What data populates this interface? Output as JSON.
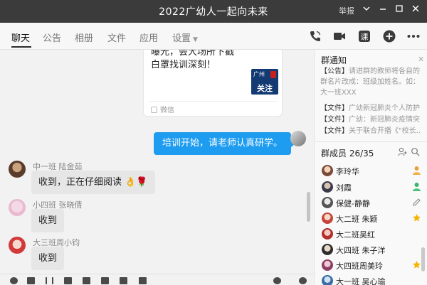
{
  "window": {
    "title": "2022广幼人一起向未来",
    "report_label": "举报"
  },
  "tabs": [
    {
      "label": "聊天",
      "active": true
    },
    {
      "label": "公告"
    },
    {
      "label": "相册"
    },
    {
      "label": "文件"
    },
    {
      "label": "应用"
    },
    {
      "label": "设置"
    }
  ],
  "toolbar_icons": [
    "phone-icon",
    "video-icon",
    "course-icon",
    "add-icon",
    "more-icon"
  ],
  "toolbar": {
    "course_label": "课"
  },
  "chat": {
    "share_card": {
      "text": "曝光，会大场所下戳白罩找训深刻！",
      "logo_text": "广州",
      "logo_follow": "关注",
      "source": "微信"
    },
    "my_message": "培训开始，请老师认真研学。",
    "messages": [
      {
        "name": "中一班 陆金茹",
        "text": "收到，正在仔细阅读",
        "emoji": "👌🌹"
      },
      {
        "name": "小四班 张晓倩",
        "text": "收到"
      },
      {
        "name": "大三班周小钧",
        "text": "收到"
      }
    ]
  },
  "panel": {
    "notice_title": "群通知",
    "notices": [
      {
        "tag": "【公告】",
        "text": "请进群的教师将各自的群名片改成：班级加姓名。如：大一班XXX"
      },
      {
        "tag": "【文件】",
        "text": "广幼新冠肺炎个人防护..."
      },
      {
        "tag": "【文件】",
        "text": "广幼：新冠肺炎疫情突..."
      },
      {
        "tag": "【文件】",
        "text": "关于联合开播《\"校长..."
      }
    ],
    "member_title": "群成员 26/35",
    "members": [
      {
        "name": "李玲华",
        "role": "owner"
      },
      {
        "name": "刘霞",
        "role": "admin"
      },
      {
        "name": "保健-静静",
        "role": "edit"
      },
      {
        "name": "大二班 朱颖",
        "role": "star"
      },
      {
        "name": "大二班吴红",
        "role": ""
      },
      {
        "name": "大四班 朱子洋",
        "role": ""
      },
      {
        "name": "大四班周美玲",
        "role": "star"
      },
      {
        "name": "大一班 吴心瑜",
        "role": ""
      }
    ]
  },
  "colors": {
    "titlebar": "#3b3b3b",
    "my_bubble": "#1e9cf0",
    "other_bubble": "#e6e6e6",
    "star": "#f5b400"
  }
}
